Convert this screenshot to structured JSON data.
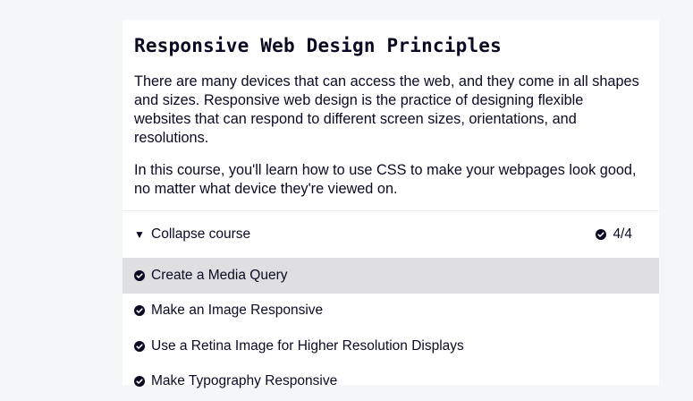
{
  "course": {
    "title": "Responsive Web Design Principles",
    "intro_paragraphs": [
      "There are many devices that can access the web, and they come in all shapes and sizes. Responsive web design is the practice of designing flexible websites that can respond to different screen sizes, orientations, and resolutions.",
      "In this course, you'll learn how to use CSS to make your webpages look good, no matter what device they're viewed on."
    ],
    "collapse_label": "Collapse course",
    "caret_icon": "triangle-down-icon",
    "progress": "4/4",
    "check_icon": "check-circle-icon",
    "lessons": [
      {
        "label": "Create a Media Query",
        "completed": true,
        "active": true
      },
      {
        "label": "Make an Image Responsive",
        "completed": true,
        "active": false
      },
      {
        "label": "Use a Retina Image for Higher Resolution Displays",
        "completed": true,
        "active": false
      },
      {
        "label": "Make Typography Responsive",
        "completed": true,
        "active": false
      }
    ]
  },
  "colors": {
    "text": "#0a0a23",
    "background": "#f5f6f7",
    "card": "#ffffff",
    "active_row": "#dfdfe2"
  }
}
